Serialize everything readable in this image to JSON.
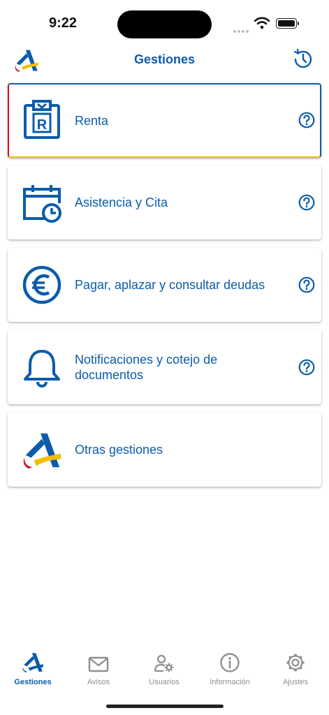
{
  "status_bar": {
    "time": "9:22"
  },
  "nav": {
    "title": "Gestiones",
    "logo_icon": "aeat-logo-icon",
    "history_icon": "history-clock-icon"
  },
  "cards": [
    {
      "label": "Renta",
      "icon": "renta-clipboard-icon",
      "help": true,
      "active": true
    },
    {
      "label": "Asistencia y Cita",
      "icon": "calendar-clock-icon",
      "help": true
    },
    {
      "label": "Pagar, aplazar y consultar deudas",
      "icon": "euro-icon",
      "help": true
    },
    {
      "label": "Notificaciones y cotejo de documentos",
      "icon": "bell-icon",
      "help": true
    },
    {
      "label": "Otras gestiones",
      "icon": "aeat-logo-icon",
      "help": false
    }
  ],
  "tabs": [
    {
      "label": "Gestiones",
      "icon": "aeat-logo-icon",
      "selected": true
    },
    {
      "label": "Avisos",
      "icon": "envelope-icon"
    },
    {
      "label": "Usuarios",
      "icon": "user-gear-icon"
    },
    {
      "label": "Información",
      "icon": "info-icon"
    },
    {
      "label": "Ajustes",
      "icon": "gear-icon"
    }
  ],
  "colors": {
    "brand_blue": "#0b5cab",
    "red": "#c8102e",
    "yellow": "#f1bf00",
    "inactive_gray": "#8e8e93"
  }
}
